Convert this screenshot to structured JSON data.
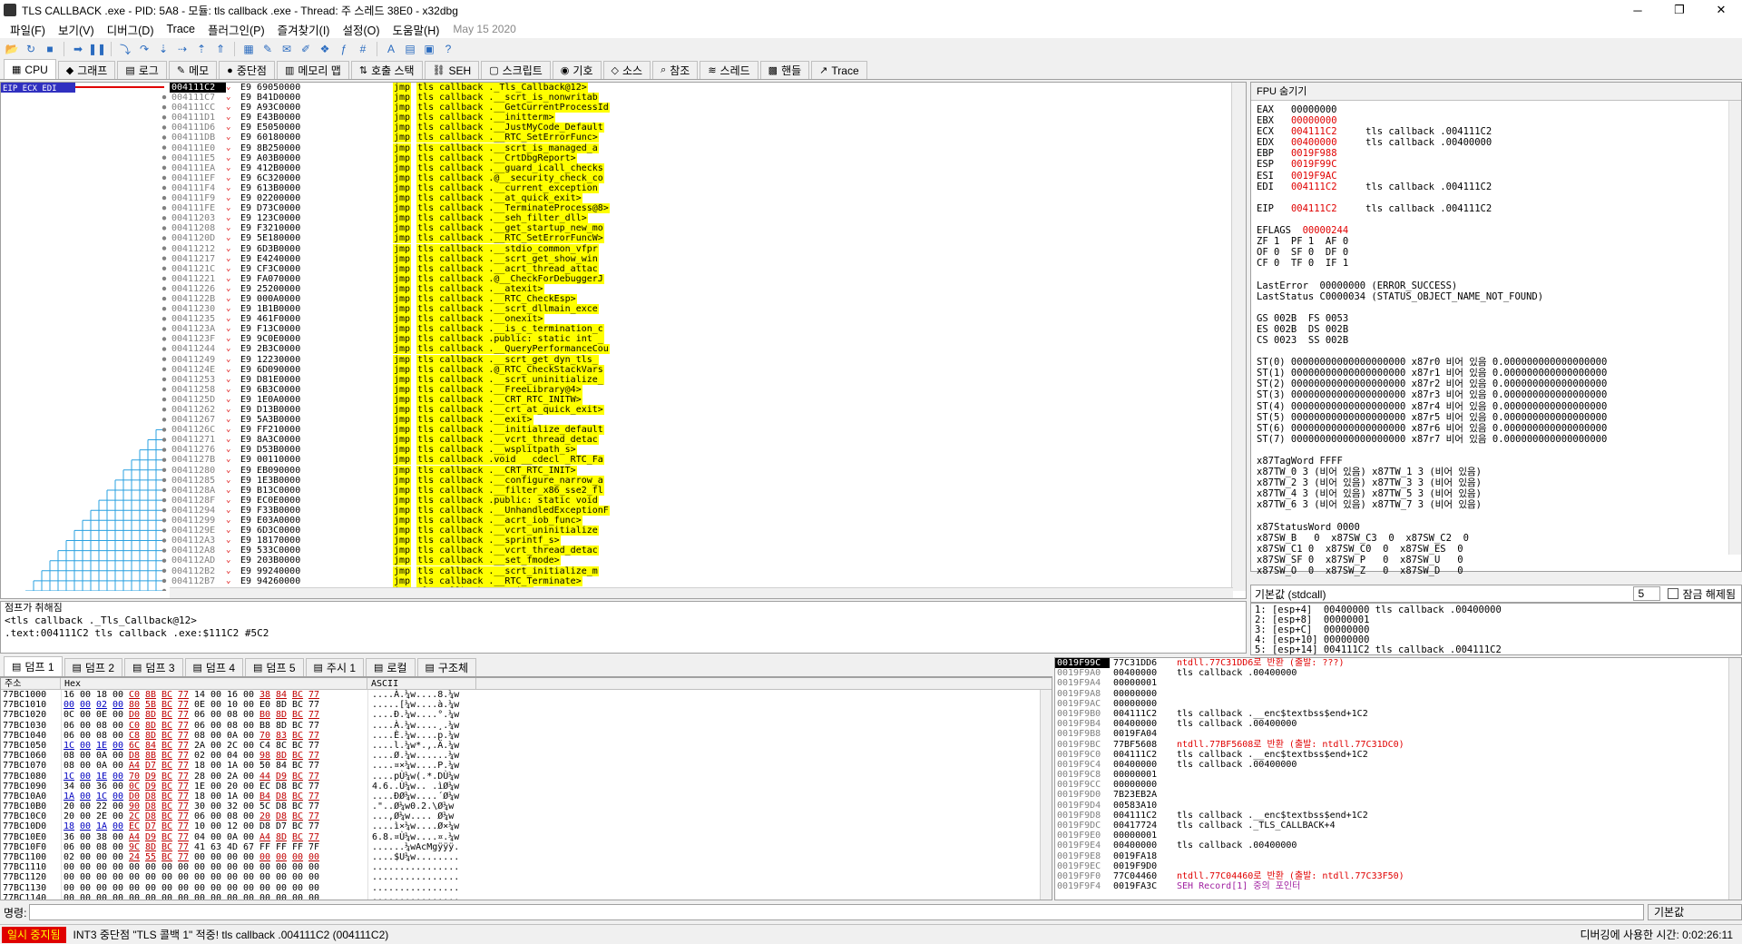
{
  "window": {
    "title": "TLS CALLBACK .exe - PID: 5A8 - 모듈: tls callback .exe - Thread: 주 스레드 38E0 - x32dbg",
    "min": "─",
    "max": "❐",
    "close": "✕"
  },
  "menu": {
    "items": [
      "파일(F)",
      "보기(V)",
      "디버그(D)",
      "Trace",
      "플러그인(P)",
      "즐겨찾기(I)",
      "설정(O)",
      "도움말(H)"
    ],
    "date": "May 15 2020"
  },
  "toolbar": {
    "icons": [
      "open-icon",
      "restart-icon",
      "stop-icon",
      "run-icon",
      "pause-icon",
      "step-into-icon",
      "step-over-icon",
      "trace-into-icon",
      "trace-over-icon",
      "execute-till-return-icon",
      "run-to-user-icon",
      "script-icon",
      "patch-icon",
      "comment-icon",
      "label-icon",
      "bookmark-icon",
      "function-icon",
      "hash-icon",
      "font-icon",
      "calc-icon",
      "memmap-icon",
      "help-icon"
    ]
  },
  "tabs": [
    {
      "label": "CPU",
      "icon": "cpu-icon"
    },
    {
      "label": "그래프",
      "icon": "graph-icon"
    },
    {
      "label": "로그",
      "icon": "log-icon"
    },
    {
      "label": "메모",
      "icon": "notes-icon"
    },
    {
      "label": "중단점",
      "icon": "breakpoint-icon"
    },
    {
      "label": "메모리 맵",
      "icon": "memory-map-icon"
    },
    {
      "label": "호출 스택",
      "icon": "call-stack-icon"
    },
    {
      "label": "SEH",
      "icon": "seh-icon"
    },
    {
      "label": "스크립트",
      "icon": "script-icon"
    },
    {
      "label": "기호",
      "icon": "symbols-icon"
    },
    {
      "label": "소스",
      "icon": "source-icon"
    },
    {
      "label": "참조",
      "icon": "references-icon"
    },
    {
      "label": "스레드",
      "icon": "threads-icon"
    },
    {
      "label": "핸들",
      "icon": "handles-icon"
    },
    {
      "label": "Trace",
      "icon": "trace-icon"
    }
  ],
  "disasm": {
    "eip_label": "EIP ECX EDI",
    "rows": [
      {
        "addr": "004111C2",
        "bytes": "E9 69050000",
        "target": "tls callback ._Tls_Callback@12>"
      },
      {
        "addr": "004111C7",
        "bytes": "E9 B41D0000",
        "target": "tls callback .__scrt_is_nonwritab"
      },
      {
        "addr": "004111CC",
        "bytes": "E9 A93C0000",
        "target": "tls callback .__GetCurrentProcessId"
      },
      {
        "addr": "004111D1",
        "bytes": "E9 E43B0000",
        "target": "tls callback .__initterm>"
      },
      {
        "addr": "004111D6",
        "bytes": "E9 E5050000",
        "target": "tls callback .__JustMyCode_Default"
      },
      {
        "addr": "004111DB",
        "bytes": "E9 60180000",
        "target": "tls callback .__RTC_SetErrorFunc>"
      },
      {
        "addr": "004111E0",
        "bytes": "E9 8B250000",
        "target": "tls callback .__scrt_is_managed_a"
      },
      {
        "addr": "004111E5",
        "bytes": "E9 A03B0000",
        "target": "tls callback .__CrtDbgReport>"
      },
      {
        "addr": "004111EA",
        "bytes": "E9 412B0000",
        "target": "tls callback .__guard_icall_checks"
      },
      {
        "addr": "004111EF",
        "bytes": "E9 6C320000",
        "target": "tls callback .@__security_check_co"
      },
      {
        "addr": "004111F4",
        "bytes": "E9 613B0000",
        "target": "tls callback .__current_exception"
      },
      {
        "addr": "004111F9",
        "bytes": "E9 02200000",
        "target": "tls callback .__at_quick_exit>"
      },
      {
        "addr": "004111FE",
        "bytes": "E9 D73C0000",
        "target": "tls callback .__TerminateProcess@8>"
      },
      {
        "addr": "00411203",
        "bytes": "E9 123C0000",
        "target": "tls callback .__seh_filter_dll>"
      },
      {
        "addr": "00411208",
        "bytes": "E9 F3210000",
        "target": "tls callback .__get_startup_new_mo"
      },
      {
        "addr": "0041120D",
        "bytes": "E9 5E180000",
        "target": "tls callback .__RTC_SetErrorFuncW>"
      },
      {
        "addr": "00411212",
        "bytes": "E9 6D3B0000",
        "target": "tls callback .__stdio_common_vfpr"
      },
      {
        "addr": "00411217",
        "bytes": "E9 E4240000",
        "target": "tls callback .__scrt_get_show_win"
      },
      {
        "addr": "0041121C",
        "bytes": "E9 CF3C0000",
        "target": "tls callback .__acrt_thread_attac"
      },
      {
        "addr": "00411221",
        "bytes": "E9 FA070000",
        "target": "tls callback .@__CheckForDebuggerJ"
      },
      {
        "addr": "00411226",
        "bytes": "E9 25200000",
        "target": "tls callback .__atexit>"
      },
      {
        "addr": "0041122B",
        "bytes": "E9 000A0000",
        "target": "tls callback .__RTC_CheckEsp>"
      },
      {
        "addr": "00411230",
        "bytes": "E9 1B1B0000",
        "target": "tls callback .__scrt_dllmain_exce"
      },
      {
        "addr": "00411235",
        "bytes": "E9 461F0000",
        "target": "tls callback .__onexit>"
      },
      {
        "addr": "0041123A",
        "bytes": "E9 F13C0000",
        "target": "tls callback .__is_c_termination_c"
      },
      {
        "addr": "0041123F",
        "bytes": "E9 9C0E0000",
        "target": "tls callback .public: static int _"
      },
      {
        "addr": "00411244",
        "bytes": "E9 2B3C0000",
        "target": "tls callback .__QueryPerformanceCou"
      },
      {
        "addr": "00411249",
        "bytes": "E9 12230000",
        "target": "tls callback .__scrt_get_dyn_tls_"
      },
      {
        "addr": "0041124E",
        "bytes": "E9 6D090000",
        "target": "tls callback .@_RTC_CheckStackVars"
      },
      {
        "addr": "00411253",
        "bytes": "E9 D81E0000",
        "target": "tls callback .__scrt_uninitialize_"
      },
      {
        "addr": "00411258",
        "bytes": "E9 6B3C0000",
        "target": "tls callback .__FreeLibrary@4>"
      },
      {
        "addr": "0041125D",
        "bytes": "E9 1E0A0000",
        "target": "tls callback .__CRT_RTC_INITW>"
      },
      {
        "addr": "00411262",
        "bytes": "E9 D13B0000",
        "target": "tls callback .__crt_at_quick_exit>"
      },
      {
        "addr": "00411267",
        "bytes": "E9 5A3B0000",
        "target": "tls callback .__exit>"
      },
      {
        "addr": "0041126C",
        "bytes": "E9 FF210000",
        "target": "tls callback .__initialize_default"
      },
      {
        "addr": "00411271",
        "bytes": "E9 8A3C0000",
        "target": "tls callback .__vcrt_thread_detac"
      },
      {
        "addr": "00411276",
        "bytes": "E9 D53B0000",
        "target": "tls callback .__wsplitpath_s>"
      },
      {
        "addr": "0041127B",
        "bytes": "E9 00110000",
        "target": "tls callback .void __cdecl _RTC_Fa"
      },
      {
        "addr": "00411280",
        "bytes": "E9 EB090000",
        "target": "tls callback .__CRT_RTC_INIT>"
      },
      {
        "addr": "00411285",
        "bytes": "E9 1E3B0000",
        "target": "tls callback .__configure_narrow_a"
      },
      {
        "addr": "0041128A",
        "bytes": "E9 B13C0000",
        "target": "tls callback .__filter_x86_sse2_fl"
      },
      {
        "addr": "0041128F",
        "bytes": "E9 EC0E0000",
        "target": "tls callback .public: static void"
      },
      {
        "addr": "00411294",
        "bytes": "E9 F33B0000",
        "target": "tls callback .__UnhandledExceptionF"
      },
      {
        "addr": "00411299",
        "bytes": "E9 E03A0000",
        "target": "tls callback .__acrt_iob_func>"
      },
      {
        "addr": "0041129E",
        "bytes": "E9 6D3C0000",
        "target": "tls callback .__vcrt_uninitialize"
      },
      {
        "addr": "004112A3",
        "bytes": "E9 18170000",
        "target": "tls callback .__sprintf_s>"
      },
      {
        "addr": "004112A8",
        "bytes": "E9 533C0000",
        "target": "tls callback .__vcrt_thread_detac"
      },
      {
        "addr": "004112AD",
        "bytes": "E9 203B0000",
        "target": "tls callback .__set_fmode>"
      },
      {
        "addr": "004112B2",
        "bytes": "E9 99240000",
        "target": "tls callback .__scrt_initialize_m"
      },
      {
        "addr": "004112B7",
        "bytes": "E9 94260000",
        "target": "tls callback .__RTC_Terminate>"
      },
      {
        "addr": "004112BC",
        "bytes": "E9 FF050000",
        "target": "tls callback .__main>"
      }
    ]
  },
  "info": {
    "line1": "점프가 취해짐",
    "line2": "<tls callback ._Tls_Callback@12>",
    "line3": ".text:004111C2 tls callback .exe:$111C2 #5C2"
  },
  "registers": {
    "header": "FPU 숨기기",
    "lines": [
      {
        "t": "EAX   00000000"
      },
      {
        "t": "EBX   ",
        "r": "00000000"
      },
      {
        "t": "ECX   ",
        "r": "004111C2",
        "c": "     tls callback .004111C2"
      },
      {
        "t": "EDX   ",
        "r": "00400000",
        "c": "     tls callback .00400000"
      },
      {
        "t": "EBP   ",
        "r": "0019F988"
      },
      {
        "t": "ESP   ",
        "r": "0019F99C"
      },
      {
        "t": "ESI   ",
        "r": "0019F9AC"
      },
      {
        "t": "EDI   ",
        "r": "004111C2",
        "c": "     tls callback .004111C2"
      },
      {
        "t": ""
      },
      {
        "t": "EIP   ",
        "r": "004111C2",
        "c": "     tls callback .004111C2"
      },
      {
        "t": ""
      },
      {
        "t": "EFLAGS  ",
        "r": "00000244"
      },
      {
        "t": "ZF 1  PF 1  AF 0"
      },
      {
        "t": "OF 0  SF 0  DF 0"
      },
      {
        "t": "CF 0  TF 0  IF 1"
      },
      {
        "t": ""
      },
      {
        "t": "LastError  00000000 (ERROR_SUCCESS)"
      },
      {
        "t": "LastStatus C0000034 (STATUS_OBJECT_NAME_NOT_FOUND)"
      },
      {
        "t": ""
      },
      {
        "t": "GS 002B  FS 0053"
      },
      {
        "t": "ES 002B  DS 002B"
      },
      {
        "t": "CS 0023  SS 002B"
      },
      {
        "t": ""
      },
      {
        "t": "ST(0) 00000000000000000000 x87r0 비어 있음 0.000000000000000000"
      },
      {
        "t": "ST(1) 00000000000000000000 x87r1 비어 있음 0.000000000000000000"
      },
      {
        "t": "ST(2) 00000000000000000000 x87r2 비어 있음 0.000000000000000000"
      },
      {
        "t": "ST(3) 00000000000000000000 x87r3 비어 있음 0.000000000000000000"
      },
      {
        "t": "ST(4) 00000000000000000000 x87r4 비어 있음 0.000000000000000000"
      },
      {
        "t": "ST(5) 00000000000000000000 x87r5 비어 있음 0.000000000000000000"
      },
      {
        "t": "ST(6) 00000000000000000000 x87r6 비어 있음 0.000000000000000000"
      },
      {
        "t": "ST(7) 00000000000000000000 x87r7 비어 있음 0.000000000000000000"
      },
      {
        "t": ""
      },
      {
        "t": "x87TagWord FFFF"
      },
      {
        "t": "x87TW_0 3 (비어 있음) x87TW_1 3 (비어 있음)"
      },
      {
        "t": "x87TW_2 3 (비어 있음) x87TW_3 3 (비어 있음)"
      },
      {
        "t": "x87TW_4 3 (비어 있음) x87TW_5 3 (비어 있음)"
      },
      {
        "t": "x87TW_6 3 (비어 있음) x87TW_7 3 (비어 있음)"
      },
      {
        "t": ""
      },
      {
        "t": "x87StatusWord 0000"
      },
      {
        "t": "x87SW_B   0  x87SW_C3  0  x87SW_C2  0"
      },
      {
        "t": "x87SW_C1 0  x87SW_C0  0  x87SW_ES  0"
      },
      {
        "t": "x87SW_SF 0  x87SW_P   0  x87SW_U   0"
      },
      {
        "t": "x87SW_O  0  x87SW_Z   0  x87SW_D   0"
      }
    ]
  },
  "callconv": {
    "selected": "기본값 (stdcall)",
    "count": "5",
    "lock_label": "잠금 해제됨"
  },
  "stack_args": [
    "1: [esp+4]  00400000 tls callback .00400000",
    "2: [esp+8]  00000001",
    "3: [esp+C]  00000000",
    "4: [esp+10] 00000000",
    "5: [esp+14] 004111C2 tls callback .004111C2"
  ],
  "dump_tabs": [
    {
      "label": "덤프 1",
      "icon": "dump-icon"
    },
    {
      "label": "덤프 2",
      "icon": "dump-icon"
    },
    {
      "label": "덤프 3",
      "icon": "dump-icon"
    },
    {
      "label": "덤프 4",
      "icon": "dump-icon"
    },
    {
      "label": "덤프 5",
      "icon": "dump-icon"
    },
    {
      "label": "주시 1",
      "icon": "watch-icon"
    },
    {
      "label": "로컬",
      "icon": "locals-icon"
    },
    {
      "label": "구조체",
      "icon": "struct-icon"
    }
  ],
  "dump": {
    "col_addr": "주소",
    "col_hex": "Hex",
    "col_ascii": "ASCII",
    "rows": [
      {
        "a": "77BC1000",
        "h": "16 00 18 00 C0 8B BC 77 14 00 16 00 38 84 BC 77",
        "s": "....À.¼w....8.¼w"
      },
      {
        "a": "77BC1010",
        "h": "00 00 02 00 80 5B BC 77 0E 00 10 00 E0 8D BC 77",
        "s": ".....[¼w....à.¼w"
      },
      {
        "a": "77BC1020",
        "h": "0C 00 0E 00 D0 8D BC 77 06 00 08 00 B0 8D BC 77",
        "s": "....Ð.¼w....°.¼w"
      },
      {
        "a": "77BC1030",
        "h": "06 00 08 00 C0 8D BC 77 06 00 08 00 B8 8D BC 77",
        "s": "....À.¼w....¸.¼w"
      },
      {
        "a": "77BC1040",
        "h": "06 00 08 00 C8 8D BC 77 08 00 0A 00 70 83 BC 77",
        "s": "....È.¼w....p.¼w"
      },
      {
        "a": "77BC1050",
        "h": "1C 00 1E 00 6C 84 BC 77 2A 00 2C 00 C4 8C BC 77",
        "s": "....l.¼w*.,.Ä.¼w"
      },
      {
        "a": "77BC1060",
        "h": "08 00 0A 00 D8 8B BC 77 02 00 04 00 98 8D BC 77",
        "s": "....Ø.¼w......¼w"
      },
      {
        "a": "77BC1070",
        "h": "08 00 0A 00 A4 D7 BC 77 18 00 1A 00 50 84 BC 77",
        "s": "....¤×¼w....P.¼w"
      },
      {
        "a": "77BC1080",
        "h": "1C 00 1E 00 70 D9 BC 77 28 00 2A 00 44 D9 BC 77",
        "s": "....pÙ¼w(.*.DÙ¼w"
      },
      {
        "a": "77BC1090",
        "h": "34 00 36 00 0C D9 BC 77 1E 00 20 00 EC D8 BC 77",
        "s": "4.6..Ù¼w.. .ìØ¼w"
      },
      {
        "a": "77BC10A0",
        "h": "1A 00 1C 00 D0 D8 BC 77 18 00 1A 00 B4 D8 BC 77",
        "s": "....ÐØ¼w....´Ø¼w"
      },
      {
        "a": "77BC10B0",
        "h": "20 00 22 00 90 D8 BC 77 30 00 32 00 5C D8 BC 77",
        "s": " .\"..Ø¼w0.2.\\Ø¼w"
      },
      {
        "a": "77BC10C0",
        "h": "20 00 2E 00 2C D8 BC 77 06 00 08 00 20 D8 BC 77",
        "s": " ...,Ø¼w.... Ø¼w"
      },
      {
        "a": "77BC10D0",
        "h": "18 00 1A 00 EC D7 BC 77 10 00 12 00 D8 D7 BC 77",
        "s": "....ì×¼w....Ø×¼w"
      },
      {
        "a": "77BC10E0",
        "h": "36 00 38 00 A4 D9 BC 77 04 00 0A 00 A4 8D BC 77",
        "s": "6.8.¤Ù¼w....¤.¼w"
      },
      {
        "a": "77BC10F0",
        "h": "06 00 08 00 9C 8D BC 77 41 63 4D 67 FF FF FF 7F",
        "s": "......¼wAcMgÿÿÿ."
      },
      {
        "a": "77BC1100",
        "h": "02 00 00 00 24 55 BC 77 00 00 00 00 00 00 00 00",
        "s": "....$U¼w........"
      },
      {
        "a": "77BC1110",
        "h": "00 00 00 00 00 00 00 00 00 00 00 00 00 00 00 00",
        "s": "................"
      },
      {
        "a": "77BC1120",
        "h": "00 00 00 00 00 00 00 00 00 00 00 00 00 00 00 00",
        "s": "................"
      },
      {
        "a": "77BC1130",
        "h": "00 00 00 00 00 00 00 00 00 00 00 00 00 00 00 00",
        "s": "................"
      },
      {
        "a": "77BC1140",
        "h": "00 00 00 00 00 00 00 00 00 00 00 00 00 00 00 00",
        "s": "................"
      }
    ]
  },
  "stack": {
    "rows": [
      {
        "a": "0019F99C",
        "v": "77C31DD6",
        "c": "ntdll.77C31DD6로 반환 (출발: ???)",
        "k": "r"
      },
      {
        "a": "0019F9A0",
        "v": "00400000",
        "c": "tls callback .00400000"
      },
      {
        "a": "0019F9A4",
        "v": "00000001",
        "c": ""
      },
      {
        "a": "0019F9A8",
        "v": "00000000",
        "c": ""
      },
      {
        "a": "0019F9AC",
        "v": "00000000",
        "c": ""
      },
      {
        "a": "0019F9B0",
        "v": "004111C2",
        "c": "tls callback .__enc$textbss$end+1C2"
      },
      {
        "a": "0019F9B4",
        "v": "00400000",
        "c": "tls callback .00400000"
      },
      {
        "a": "0019F9B8",
        "v": "0019FA04",
        "c": ""
      },
      {
        "a": "0019F9BC",
        "v": "77BF5608",
        "c": "ntdll.77BF5608로 반환 (출발: ntdll.77C31DC0)",
        "k": "r"
      },
      {
        "a": "0019F9C0",
        "v": "004111C2",
        "c": "tls callback .__enc$textbss$end+1C2"
      },
      {
        "a": "0019F9C4",
        "v": "00400000",
        "c": "tls callback .00400000"
      },
      {
        "a": "0019F9C8",
        "v": "00000001",
        "c": ""
      },
      {
        "a": "0019F9CC",
        "v": "00000000",
        "c": ""
      },
      {
        "a": "0019F9D0",
        "v": "7B23EB2A",
        "c": ""
      },
      {
        "a": "0019F9D4",
        "v": "00583A10",
        "c": ""
      },
      {
        "a": "0019F9D8",
        "v": "004111C2",
        "c": "tls callback .__enc$textbss$end+1C2"
      },
      {
        "a": "0019F9DC",
        "v": "00417724",
        "c": "tls callback ._TLS_CALLBACK+4"
      },
      {
        "a": "0019F9E0",
        "v": "00000001",
        "c": ""
      },
      {
        "a": "0019F9E4",
        "v": "00400000",
        "c": "tls callback .00400000"
      },
      {
        "a": "0019F9E8",
        "v": "0019FA18",
        "c": ""
      },
      {
        "a": "0019F9EC",
        "v": "0019F9D0",
        "c": ""
      },
      {
        "a": "0019F9F0",
        "v": "77C04460",
        "c": "ntdll.77C04460로 반환 (출발: ntdll.77C33F50)",
        "k": "r"
      },
      {
        "a": "0019F9F4",
        "v": "0019FA3C",
        "c": "SEH Record[1] 중의 포인터",
        "k": "p"
      }
    ]
  },
  "command": {
    "label": "명령:",
    "default": "기본값"
  },
  "status": {
    "paused": "일시 중지됨",
    "message": "INT3 중단점 \"TLS 콜백 1\" 적중! tls callback .004111C2 (004111C2)",
    "time": "디버깅에 사용한 시간: 0:02:26:11"
  },
  "colors": {
    "paused_bg": "#e00000",
    "jmp_bg": "#ffff00",
    "reg_changed": "#e00000"
  }
}
